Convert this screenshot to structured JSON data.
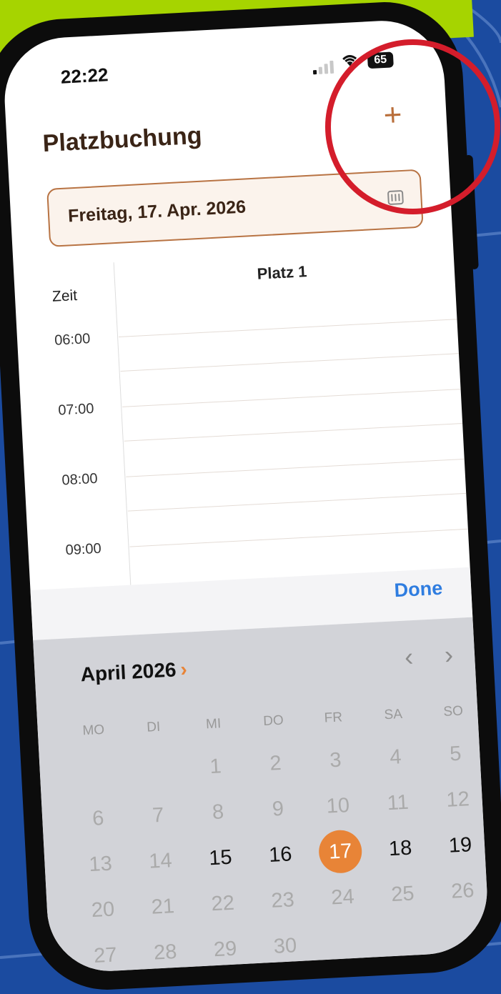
{
  "status_bar": {
    "time": "22:22",
    "battery": "65"
  },
  "header": {
    "title": "Platzbuchung",
    "add_label": "+"
  },
  "date_field": {
    "value": "Freitag, 17. Apr. 2026",
    "icon": "calendar-icon"
  },
  "schedule": {
    "time_column_header": "Zeit",
    "court_header": "Platz 1",
    "times": [
      "06:00",
      "07:00",
      "08:00",
      "09:00"
    ]
  },
  "toolbar": {
    "done_label": "Done"
  },
  "calendar": {
    "month_label": "April 2026",
    "month_chevron": "›",
    "prev_label": "‹",
    "next_label": "›",
    "weekdays": [
      "MO",
      "DI",
      "MI",
      "DO",
      "FR",
      "SA",
      "SO"
    ],
    "rows": [
      [
        "",
        "",
        "1",
        "2",
        "3",
        "4",
        "5"
      ],
      [
        "6",
        "7",
        "8",
        "9",
        "10",
        "11",
        "12"
      ],
      [
        "13",
        "14",
        "15",
        "16",
        "17",
        "18",
        "19"
      ],
      [
        "20",
        "21",
        "22",
        "23",
        "24",
        "25",
        "26"
      ],
      [
        "27",
        "28",
        "29",
        "30",
        "",
        "",
        ""
      ]
    ],
    "selected_day": "17",
    "available_days": [
      "15",
      "16",
      "17",
      "18",
      "19"
    ]
  },
  "colors": {
    "accent": "#e88437",
    "brand_brown": "#b87343",
    "done_blue": "#2f7de0",
    "highlight_ring": "#d41d2b"
  }
}
